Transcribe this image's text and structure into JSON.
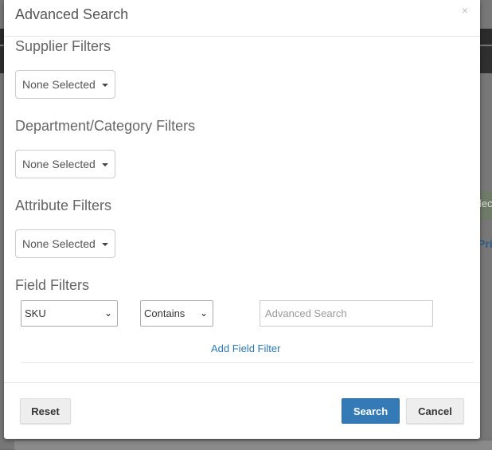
{
  "modal": {
    "title": "Advanced Search",
    "close": "×"
  },
  "sections": {
    "supplier": {
      "title": "Supplier Filters",
      "value": "None Selected"
    },
    "department": {
      "title": "Department/Category Filters",
      "value": "None Selected"
    },
    "attribute": {
      "title": "Attribute Filters",
      "value": "None Selected"
    },
    "field": {
      "title": "Field Filters"
    }
  },
  "field_filter": {
    "field_select": "SKU",
    "operator_select": "Contains",
    "search_placeholder": "Advanced Search",
    "add_link": "Add Field Filter"
  },
  "footer": {
    "reset": "Reset",
    "search": "Search",
    "cancel": "Cancel"
  },
  "background": {
    "fragment1": "lec",
    "fragment2": "Pri"
  },
  "colors": {
    "primary": "#337ab7",
    "link": "#2a7ab8"
  }
}
